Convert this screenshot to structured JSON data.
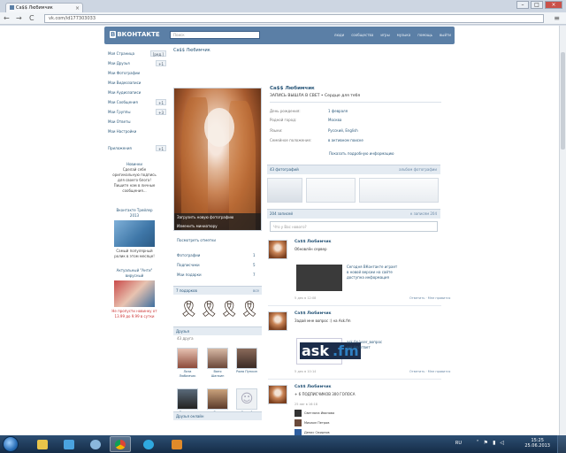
{
  "browser": {
    "tab_title": "Ca$$ Любимчик",
    "tab_close": "×",
    "back": "←",
    "forward": "→",
    "reload": "C",
    "url": "vk.com/id177303033",
    "menu_icon": "wrench-icon"
  },
  "header": {
    "logo_prefix": "В",
    "logo_text": "ВКОНТАКТЕ",
    "search_placeholder": "Поиск",
    "nav": [
      "люди",
      "сообщества",
      "игры",
      "музыка",
      "помощь",
      "выйти"
    ]
  },
  "menu": {
    "items": [
      {
        "label": "Моя Страница",
        "count": "[ред.]"
      },
      {
        "label": "Мои Друзья",
        "count": "+1"
      },
      {
        "label": "Мои Фотографии",
        "count": ""
      },
      {
        "label": "Мои Видеозаписи",
        "count": ""
      },
      {
        "label": "Мои Аудиозаписи",
        "count": ""
      },
      {
        "label": "Мои Сообщения",
        "count": "+1"
      },
      {
        "label": "Мои Группы",
        "count": "+3"
      },
      {
        "label": "Мои Ответы",
        "count": ""
      },
      {
        "label": "Мои Настройки",
        "count": ""
      },
      {
        "label": "Приложения",
        "count": "+1"
      }
    ],
    "ads": [
      {
        "title": "Новинки",
        "text": "Сделай себе оригинальную подпись для своего блога! Пишите нам в личные сообщения..."
      },
      {
        "title": "Вконтакте Трейлер 2013",
        "text": "Самый популярный ролик в этом месяце!"
      },
      {
        "title": "Актуальный \"Анти\" вирусный",
        "text": "Не пропусти новинку от 13.99 до 9.99 в сутки"
      }
    ]
  },
  "profile": {
    "short_name": "Ca$$ Любимчик",
    "full_name": "Ca$$ Любимчик",
    "status": "ЗАПИСЬ ВЫШЛА В СВЕТ • Сердце для тебя",
    "info": [
      {
        "key": "День рождения:",
        "value": "1 февраля"
      },
      {
        "key": "Родной город:",
        "value": "Москва"
      },
      {
        "key": "Семейное положение:",
        "value": "в активном поиске"
      },
      {
        "key": "Языки:",
        "value": "Русский, English"
      }
    ],
    "details_link": "Показать подробную информацию",
    "photo_caption_top": "Загрузить новую фотографию",
    "photo_caption_bottom": "Изменить миниатюру",
    "side_links": [
      {
        "label": "Посмотреть отметки",
        "count": ""
      },
      {
        "label": "Фотографии",
        "count": "1"
      },
      {
        "label": "Подписчики",
        "count": "5"
      },
      {
        "label": "Мои подарки",
        "count": "7"
      }
    ],
    "gifts_header": "7 подарков",
    "gifts_all": "все",
    "friends_header": "Друзья",
    "friends_count": "43 друга",
    "friends": [
      "Лиза Любимчик",
      "Ваня Шапкин",
      "Рома Пупкин",
      "Владимир Дима",
      "Ваня Будущий",
      "Сергей"
    ],
    "online_header": "Друзья онлайн"
  },
  "main": {
    "photos_header": "43 фотографий",
    "photos_all": "альбом фотографии",
    "wall_header": "204 записей",
    "wall_all": "к записям 204",
    "wall_placeholder": "Что у Вас нового?",
    "posts": [
      {
        "name": "Ca$$ Любимчик",
        "text": "Обновлён сервер",
        "desc": [
          "Сегодня ВКонтакте играет",
          "в новой версии на сайте",
          "доступна информация"
        ],
        "meta": "5 дек в 12:08",
        "action": "Ответить · Мне нравится"
      },
      {
        "name": "Ca$$ Любимчик",
        "text": "Задай мне вопрос :) на Ask.fm",
        "desc": [
          "ask.fm/user_вопрос",
          "ask.fm/ответ"
        ],
        "meta": "5 дек в 10:14",
        "action": "Ответить · Мне нравится"
      },
      {
        "name": "Ca$$ Любимчик",
        "text": "+ 6 ПОДПИСЧИКОВ 300 ГОЛОСА",
        "meta": "25 авг в 16:18",
        "comments": [
          "Светлана Иванова",
          "Михаил Петров",
          "Денис Смирнов"
        ]
      }
    ]
  },
  "taskbar": {
    "lang": "RU",
    "time": "15:25",
    "date": "25.06.2013"
  }
}
